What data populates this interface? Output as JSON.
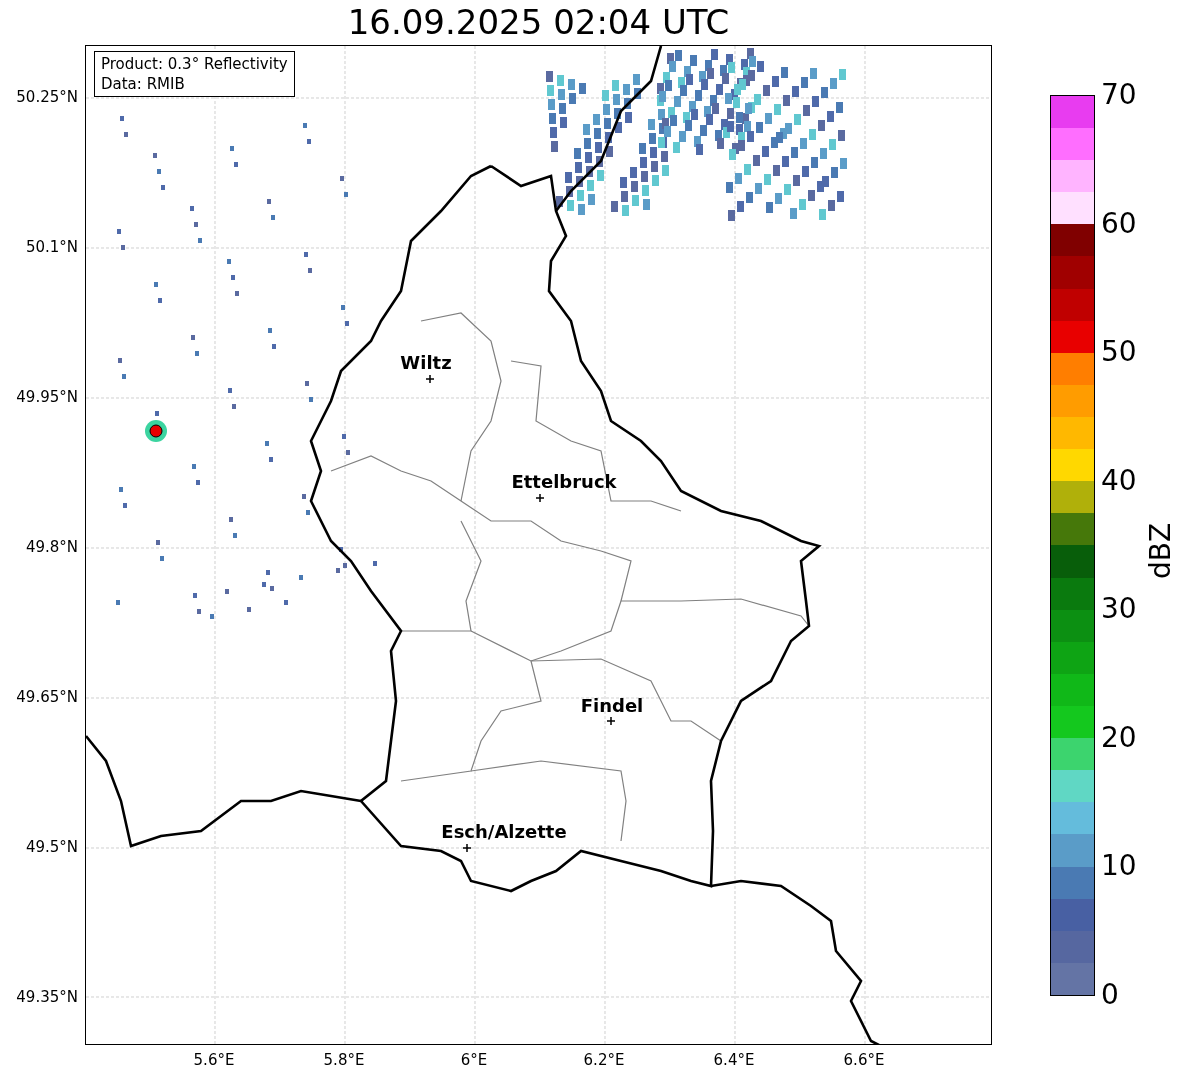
{
  "title": "16.09.2025 02:04 UTC",
  "annotation": {
    "lines": [
      "Product: 0.3° Reflectivity",
      "Data: RMIB"
    ]
  },
  "y_ticks": [
    "50.25°N",
    "50.1°N",
    "49.95°N",
    "49.8°N",
    "49.65°N",
    "49.5°N",
    "49.35°N"
  ],
  "x_ticks": [
    "5.6°E",
    "5.8°E",
    "6°E",
    "6.2°E",
    "6.4°E",
    "6.6°E"
  ],
  "cities": [
    {
      "name": "Wiltz"
    },
    {
      "name": "Ettelbruck"
    },
    {
      "name": "Findel"
    },
    {
      "name": "Esch/Alzette"
    }
  ],
  "colorbar": {
    "label": "dBZ",
    "ticks": [
      "70",
      "60",
      "50",
      "40",
      "30",
      "20",
      "10",
      "0"
    ],
    "bins": [
      {
        "color": "#6474a5"
      },
      {
        "color": "#5667a0"
      },
      {
        "color": "#4860a3"
      },
      {
        "color": "#4a7ab3"
      },
      {
        "color": "#5a9cc8"
      },
      {
        "color": "#64bcdc"
      },
      {
        "color": "#60d7c4"
      },
      {
        "color": "#3cd46e"
      },
      {
        "color": "#14c81e"
      },
      {
        "color": "#10b818"
      },
      {
        "color": "#0ea414"
      },
      {
        "color": "#0c9012"
      },
      {
        "color": "#0a7a0e"
      },
      {
        "color": "#085e0a"
      },
      {
        "color": "#46780a"
      },
      {
        "color": "#b0b00a"
      },
      {
        "color": "#ffd800"
      },
      {
        "color": "#ffb800"
      },
      {
        "color": "#ff9c00"
      },
      {
        "color": "#ff7e00"
      },
      {
        "color": "#e80000"
      },
      {
        "color": "#c00000"
      },
      {
        "color": "#a00000"
      },
      {
        "color": "#800000"
      },
      {
        "color": "#ffe0ff"
      },
      {
        "color": "#ffb4ff"
      },
      {
        "color": "#ff6eff"
      },
      {
        "color": "#e83cf0"
      }
    ]
  }
}
